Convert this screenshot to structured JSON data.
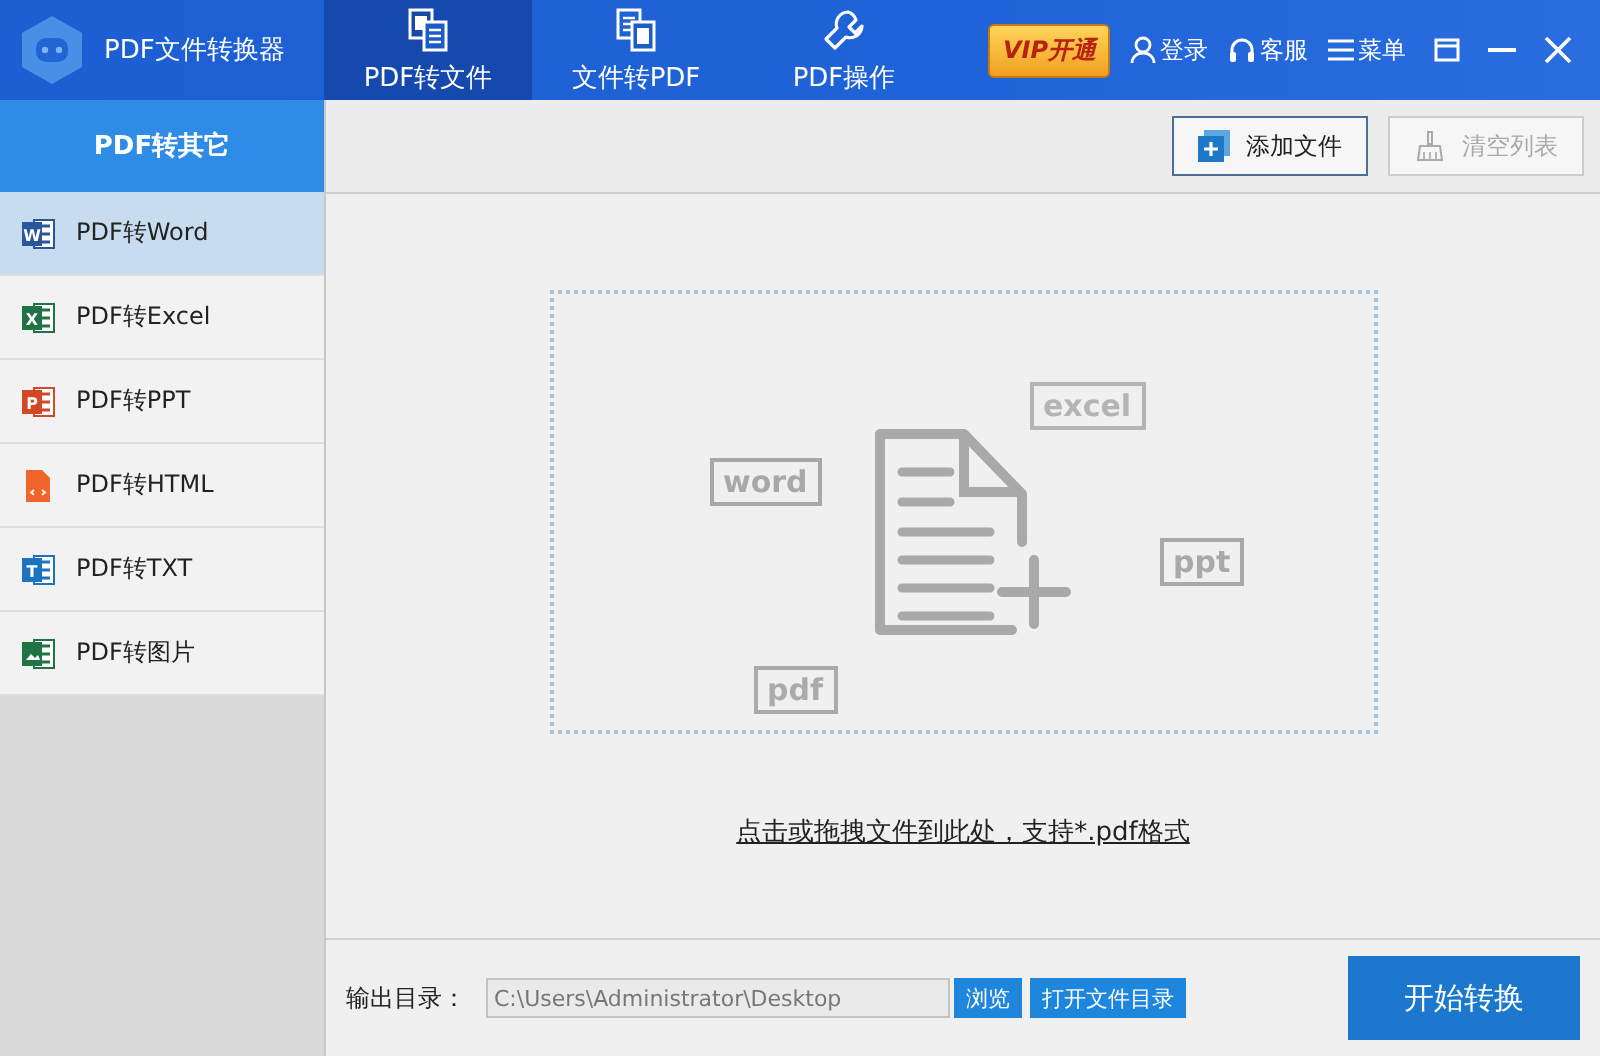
{
  "app": {
    "title": "PDF文件转换器"
  },
  "nav_tabs": [
    {
      "label": "PDF转文件",
      "selected": true,
      "kind": "pdf-to-file"
    },
    {
      "label": "文件转PDF",
      "selected": false,
      "kind": "file-to-pdf"
    },
    {
      "label": "PDF操作",
      "selected": false,
      "kind": "tools"
    }
  ],
  "top_actions": {
    "vip": "VIP开通",
    "login": "登录",
    "service": "客服",
    "menu": "菜单"
  },
  "sidebar": {
    "title": "PDF转其它",
    "items": [
      {
        "label": "PDF转Word",
        "kind": "word",
        "icon_letter": "W",
        "selected": true
      },
      {
        "label": "PDF转Excel",
        "kind": "excel",
        "icon_letter": "X",
        "selected": false
      },
      {
        "label": "PDF转PPT",
        "kind": "ppt",
        "icon_letter": "P",
        "selected": false
      },
      {
        "label": "PDF转HTML",
        "kind": "html",
        "selected": false
      },
      {
        "label": "PDF转TXT",
        "kind": "txt",
        "icon_letter": "T",
        "selected": false
      },
      {
        "label": "PDF转图片",
        "kind": "image",
        "selected": false
      }
    ]
  },
  "toolbar": {
    "add": "添加文件",
    "clear": "清空列表",
    "clear_disabled": true
  },
  "drop_zone": {
    "tags": [
      "word",
      "excel",
      "ppt",
      "pdf"
    ],
    "hint": "点击或拖拽文件到此处，支持*.pdf格式"
  },
  "footer": {
    "label": "输出目录：",
    "path": "C:\\Users\\Administrator\\Desktop",
    "browse": "浏览",
    "open_dir": "打开文件目录",
    "start": "开始转换"
  }
}
